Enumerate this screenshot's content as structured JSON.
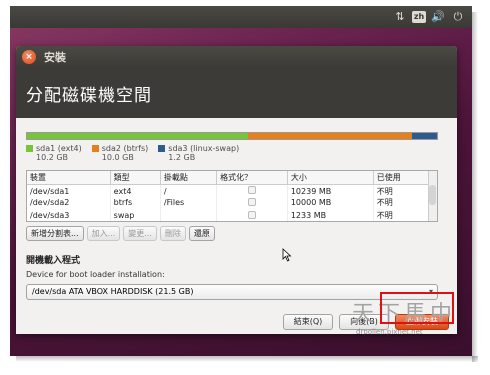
{
  "window": {
    "title": "安裝",
    "heading": "分配磁碟機空間"
  },
  "partition_bar": {
    "segments": [
      {
        "name": "sda1 (ext4)",
        "size": "10.2 GB",
        "color": "#77c43b"
      },
      {
        "name": "sda2 (btrfs)",
        "size": "10.0 GB",
        "color": "#e6801d"
      },
      {
        "name": "sda3 (linux-swap)",
        "size": "1.2 GB",
        "color": "#2c5b8f"
      }
    ]
  },
  "table": {
    "headers": [
      "裝置",
      "類型",
      "掛載點",
      "格式化？",
      "大小",
      "已使用"
    ],
    "rows": [
      {
        "device": "/dev/sda1",
        "type": "ext4",
        "mount": "/",
        "size": "10239 MB",
        "used": "不明"
      },
      {
        "device": "/dev/sda2",
        "type": "btrfs",
        "mount": "/Files",
        "size": "10000 MB",
        "used": "不明"
      },
      {
        "device": "/dev/sda3",
        "type": "swap",
        "mount": "",
        "size": "1233 MB",
        "used": "不明"
      }
    ]
  },
  "actions": {
    "new_table": "新增分割表...",
    "add": "加入...",
    "change": "變更...",
    "delete": "刪除",
    "revert": "還原"
  },
  "bootloader": {
    "section_title": "開機載入程式",
    "label": "Device for boot loader installation:",
    "selected": "/dev/sda ATA VBOX HARDDISK (21.5 GB)"
  },
  "buttons": {
    "quit": "結束(Q)",
    "back": "向後(B)",
    "forward": "立即安裝"
  },
  "watermark": {
    "text": "天下馬中",
    "sub": "drpolien.pixnet.net"
  },
  "tray": {
    "keyboard": "zh"
  }
}
